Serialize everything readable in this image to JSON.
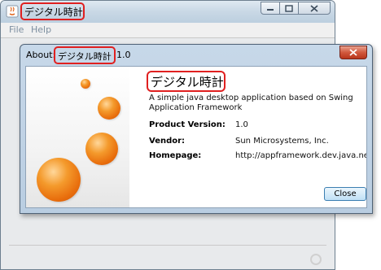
{
  "main_window": {
    "title": "デジタル時計",
    "menu": [
      "File",
      "Help"
    ]
  },
  "about_dialog": {
    "title_prefix": "About:",
    "title_name": "デジタル時計",
    "title_version": "1.0",
    "app_name": "デジタル時計",
    "description": "A simple java desktop application based on Swing Application Framework",
    "fields": [
      {
        "label": "Product Version:",
        "value": "1.0"
      },
      {
        "label": "Vendor:",
        "value": "Sun Microsystems, Inc."
      },
      {
        "label": "Homepage:",
        "value": "http://appframework.dev.java.net"
      }
    ],
    "close_label": "Close"
  },
  "colors": {
    "highlight": "#e02020",
    "accent_orange": "#e86d0c"
  },
  "icons": [
    "java-coffee-icon",
    "minimize-icon",
    "maximize-icon",
    "close-icon",
    "busy-indicator-icon"
  ]
}
